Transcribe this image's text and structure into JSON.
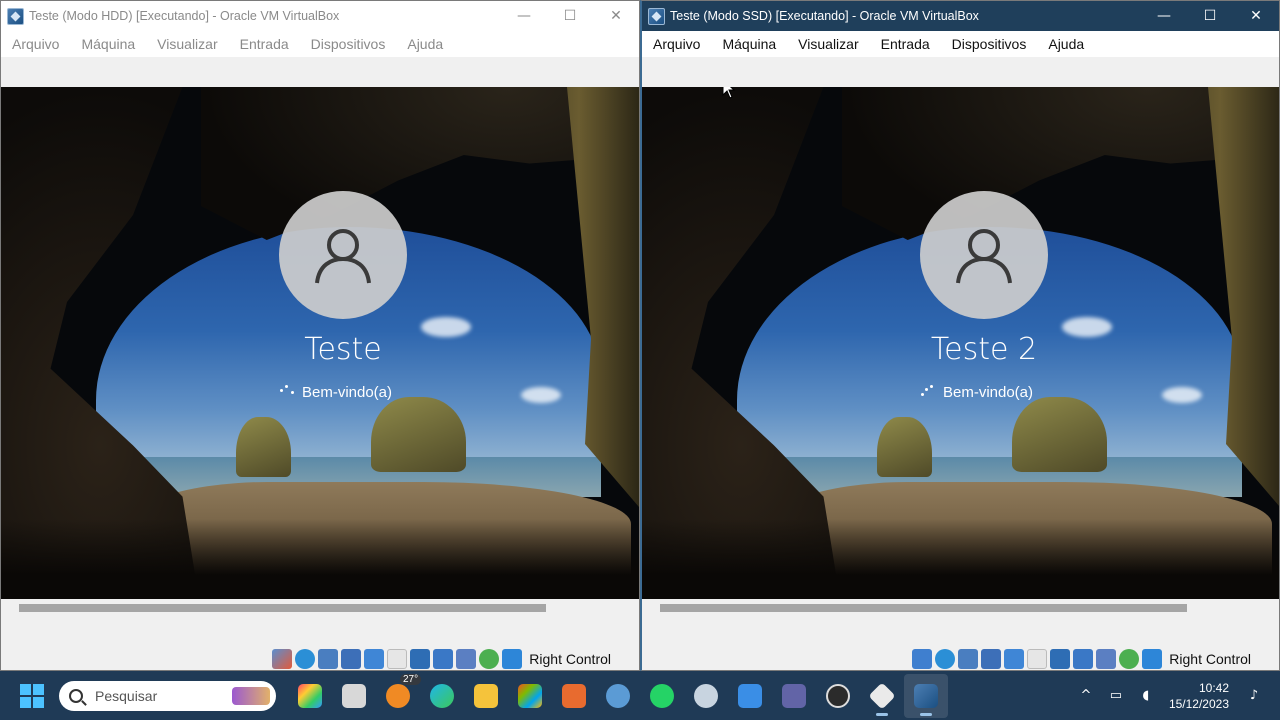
{
  "left_window": {
    "title": "Teste (Modo HDD) [Executando] - Oracle VM VirtualBox",
    "menu": [
      "Arquivo",
      "Máquina",
      "Visualizar",
      "Entrada",
      "Dispositivos",
      "Ajuda"
    ],
    "user_name": "Teste",
    "welcome": "Bem-vindo(a)",
    "host_key": "Right Control"
  },
  "right_window": {
    "title": "Teste (Modo SSD) [Executando] - Oracle VM VirtualBox",
    "menu": [
      "Arquivo",
      "Máquina",
      "Visualizar",
      "Entrada",
      "Dispositivos",
      "Ajuda"
    ],
    "user_name": "Teste 2",
    "welcome": "Bem-vindo(a)",
    "host_key": "Right Control"
  },
  "window_controls": {
    "minimize": "—",
    "maximize": "☐",
    "close": "✕"
  },
  "taskbar": {
    "search_placeholder": "Pesquisar",
    "weather_badge": "27°",
    "apps": [
      "widgets-icon",
      "file-icon",
      "weather-icon",
      "edge-icon",
      "explorer-icon",
      "store-icon",
      "media-player-icon",
      "settings-icon",
      "whatsapp-icon",
      "dvd-icon",
      "notepad-icon",
      "teams-icon",
      "obs-icon",
      "virtualbox-box-icon",
      "virtualbox-icon"
    ],
    "clock_time": "10:42",
    "clock_date": "15/12/2023"
  },
  "colors": {
    "accent": "#1f3f5b",
    "taskbar": "#1f3a56",
    "start": "#4cc2ff"
  }
}
